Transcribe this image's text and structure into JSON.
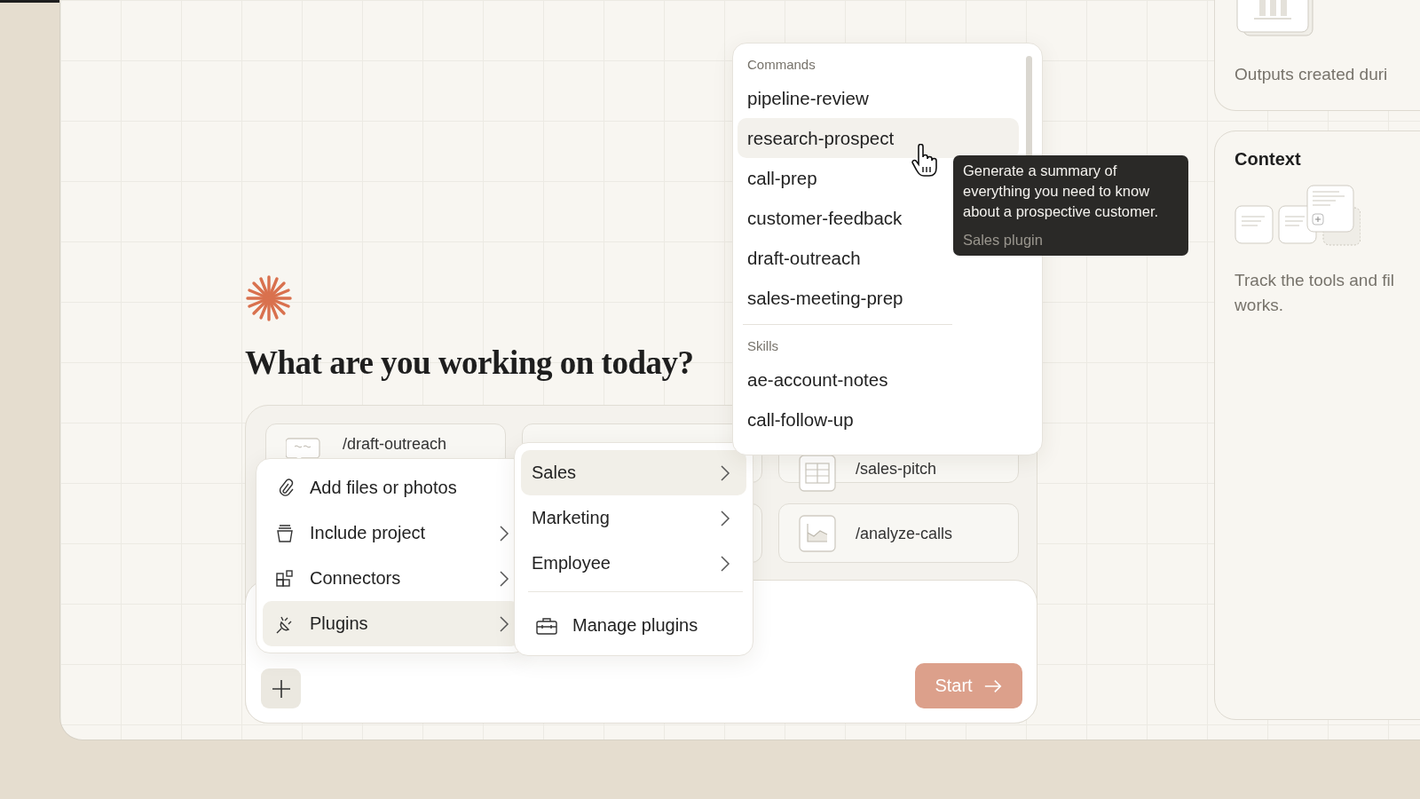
{
  "heading": "What are you working on today?",
  "shortcuts": [
    {
      "label": "/draft-outreach",
      "kind": "chat"
    },
    {
      "label": "/sales-pitch",
      "kind": "table"
    },
    {
      "label": "/analyze-calls",
      "kind": "chart"
    }
  ],
  "start_button": "Start",
  "attach_menu": [
    {
      "label": "Add files or photos",
      "has_submenu": false,
      "selected": false
    },
    {
      "label": "Include project",
      "has_submenu": true,
      "selected": false
    },
    {
      "label": "Connectors",
      "has_submenu": true,
      "selected": false
    },
    {
      "label": "Plugins",
      "has_submenu": true,
      "selected": true
    }
  ],
  "plugins_menu": {
    "items": [
      {
        "label": "Sales",
        "selected": true
      },
      {
        "label": "Marketing",
        "selected": false
      },
      {
        "label": "Employee",
        "selected": false
      }
    ],
    "action": "Manage plugins"
  },
  "command_menu": [
    {
      "title": "Commands",
      "items": [
        {
          "label": "pipeline-review",
          "selected": false
        },
        {
          "label": "research-prospect",
          "selected": true
        },
        {
          "label": "call-prep",
          "selected": false
        },
        {
          "label": "customer-feedback",
          "selected": false
        },
        {
          "label": "draft-outreach",
          "selected": false
        },
        {
          "label": "sales-meeting-prep",
          "selected": false
        }
      ]
    },
    {
      "title": "Skills",
      "items": [
        {
          "label": "ae-account-notes",
          "selected": false
        },
        {
          "label": "call-follow-up",
          "selected": false
        }
      ]
    }
  ],
  "tooltip": {
    "text": "Generate a summary of everything you need to know about a prospective customer.",
    "source": "Sales plugin"
  },
  "outputs_panel": {
    "description": "Outputs created duri"
  },
  "context_panel": {
    "title": "Context",
    "description": [
      "Track the tools and fil",
      "works."
    ]
  }
}
